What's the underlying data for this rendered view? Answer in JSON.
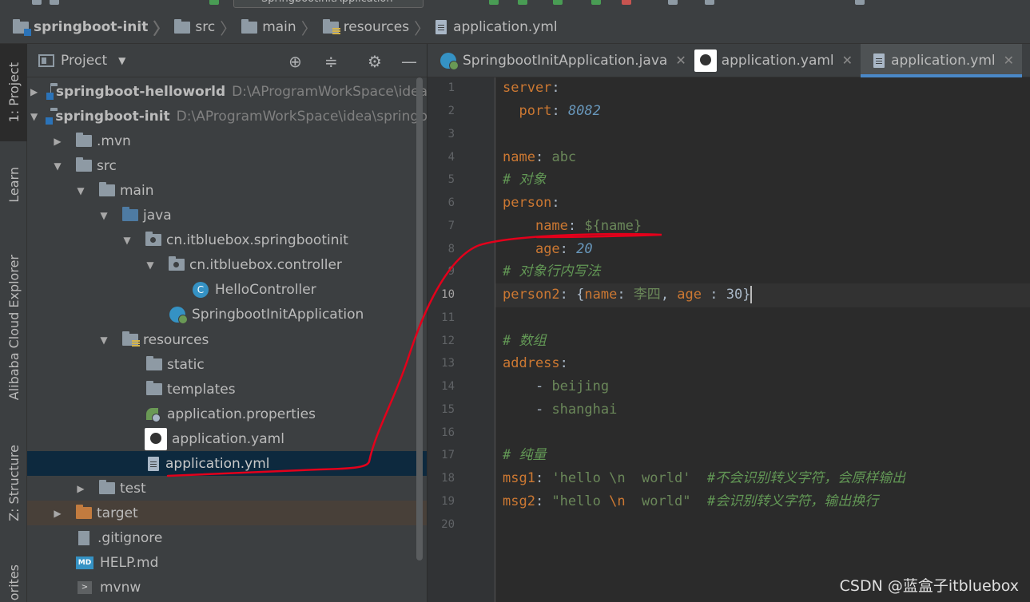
{
  "toolbar": {
    "run_config": "SpringbootInitApplication"
  },
  "breadcrumb": [
    {
      "label": "springboot-init",
      "icon": "module-folder-icon"
    },
    {
      "label": "src",
      "icon": "folder-icon"
    },
    {
      "label": "main",
      "icon": "folder-icon"
    },
    {
      "label": "resources",
      "icon": "resources-folder-icon"
    },
    {
      "label": "application.yml",
      "icon": "yml-file-icon"
    }
  ],
  "sidebar": {
    "tabs": [
      "1: Project",
      "Learn",
      "Alibaba Cloud Explorer",
      "Z: Structure",
      "orites"
    ]
  },
  "project_panel": {
    "title": "Project",
    "tree": [
      {
        "label": "springboot-helloworld",
        "path": "D:\\AProgramWorkSpace\\idea"
      },
      {
        "label": "springboot-init",
        "path": "D:\\AProgramWorkSpace\\idea\\springb"
      },
      {
        "label": ".mvn"
      },
      {
        "label": "src"
      },
      {
        "label": "main"
      },
      {
        "label": "java"
      },
      {
        "label": "cn.itbluebox.springbootinit"
      },
      {
        "label": "cn.itbluebox.controller"
      },
      {
        "label": "HelloController"
      },
      {
        "label": "SpringbootInitApplication"
      },
      {
        "label": "resources"
      },
      {
        "label": "static"
      },
      {
        "label": "templates"
      },
      {
        "label": "application.properties"
      },
      {
        "label": "application.yaml"
      },
      {
        "label": "application.yml"
      },
      {
        "label": "test"
      },
      {
        "label": "target"
      },
      {
        "label": ".gitignore"
      },
      {
        "label": "HELP.md"
      },
      {
        "label": "mvnw"
      }
    ]
  },
  "editor": {
    "tabs": [
      {
        "label": "SpringbootInitApplication.java",
        "active": false
      },
      {
        "label": "application.yaml",
        "active": false
      },
      {
        "label": "application.yml",
        "active": true
      }
    ],
    "current_line": 10,
    "line_numbers": [
      "1",
      "2",
      "3",
      "4",
      "5",
      "6",
      "7",
      "8",
      "9",
      "10",
      "11",
      "12",
      "13",
      "14",
      "15",
      "16",
      "17",
      "18",
      "19",
      "20"
    ],
    "lines": [
      "server:",
      "  port: 8082",
      "",
      "name: abc",
      "# 对象",
      "person:",
      "    name: ${name}",
      "    age: 20",
      "# 对象行内写法",
      "person2: {name: 李四, age : 30}",
      "",
      "# 数组",
      "address:",
      "    - beijing",
      "    - shanghai",
      "",
      "# 纯量",
      "msg1: 'hello \\n  world'  #不会识别转义字符，会原样输出",
      "msg2: \"hello \\n  world\"  #会识别转义字符，输出换行",
      ""
    ],
    "tokens": {
      "l1_key": "server",
      "colon": ":",
      "l2_key": "port",
      "l2_val": "8082",
      "l4_key": "name",
      "l4_val": "abc",
      "l5_comment": "# 对象",
      "l6_key": "person",
      "l7_key": "name",
      "l7_val": "${name}",
      "l8_key": "age",
      "l8_val": "20",
      "l9_comment": "# 对象行内写法",
      "l10_key": "person2",
      "l10_ikey1": "name",
      "l10_ival1": "李四",
      "l10_ikey2": "age",
      "l10_ival2": "30",
      "l12_comment": "# 数组",
      "l13_key": "address",
      "l14_val": "beijing",
      "l15_val": "shanghai",
      "l17_comment": "# 纯量",
      "l18_key": "msg1",
      "l18_val": "'hello \\n  world'",
      "l18_comment": "#不会识别转义字符，会原样输出",
      "l19_key": "msg2",
      "l19_val_a": "\"hello ",
      "l19_esc": "\\n",
      "l19_val_b": "  world\"",
      "l19_comment": "#会识别转义字符，输出换行"
    }
  },
  "watermark": "CSDN @蓝盒子itbluebox",
  "colors": {
    "keyword": "#cc7832",
    "string": "#6a8759",
    "number": "#6897bb",
    "comment": "#629755",
    "selection": "#0d293e",
    "annotation_stroke": "#e3001b"
  }
}
